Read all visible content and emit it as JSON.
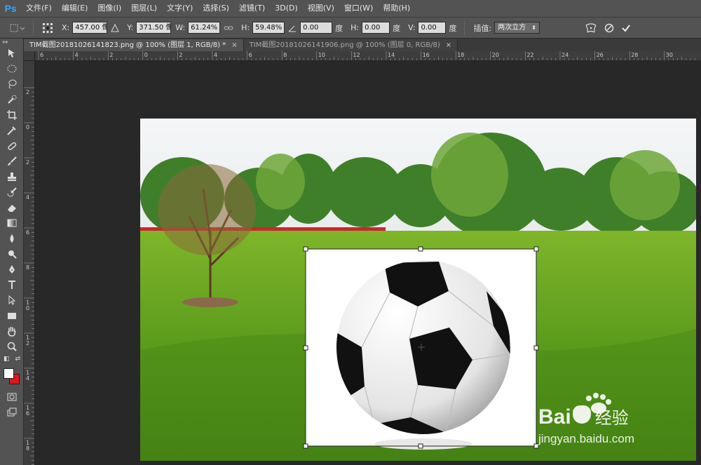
{
  "app": {
    "logo": "Ps"
  },
  "menu": [
    "文件(F)",
    "编辑(E)",
    "图像(I)",
    "图层(L)",
    "文字(Y)",
    "选择(S)",
    "滤镜(T)",
    "3D(D)",
    "视图(V)",
    "窗口(W)",
    "帮助(H)"
  ],
  "options": {
    "x_label": "X:",
    "x_value": "457.00 像素",
    "y_label": "Y:",
    "y_value": "371.50 像素",
    "w_label": "W:",
    "w_value": "61.24%",
    "h_label": "H:",
    "h_value": "59.48%",
    "angle_value": "0.00",
    "angle_unit": "度",
    "hskew_label": "H:",
    "hskew_value": "0.00",
    "hskew_unit": "度",
    "vskew_label": "V:",
    "vskew_value": "0.00",
    "vskew_unit": "度",
    "interp_label": "插值:",
    "interp_value": "两次立方"
  },
  "tabs": [
    {
      "label": "TIM截图20181026141823.png @ 100% (图层 1, RGB/8) *",
      "active": true
    },
    {
      "label": "TIM截图20181026141906.png @ 100% (图层 0, RGB/8)",
      "active": false
    }
  ],
  "ruler_h_labels": [
    "6",
    "4",
    "2",
    "0",
    "2",
    "4",
    "6",
    "8",
    "10",
    "12",
    "14",
    "16",
    "18",
    "20",
    "22",
    "24",
    "26",
    "28",
    "30"
  ],
  "ruler_v_labels": [
    "2",
    "0",
    "2",
    "4",
    "6",
    "8",
    "1 0",
    "1 2",
    "1 4",
    "1 6",
    "1 8"
  ],
  "colors": {
    "foreground": "#ffffff",
    "background": "#e2141c",
    "accent": "#31a8ff"
  },
  "watermark": {
    "brand": "Bai",
    "brand_cn": "经验",
    "url": "jingyan.baidu.com"
  }
}
